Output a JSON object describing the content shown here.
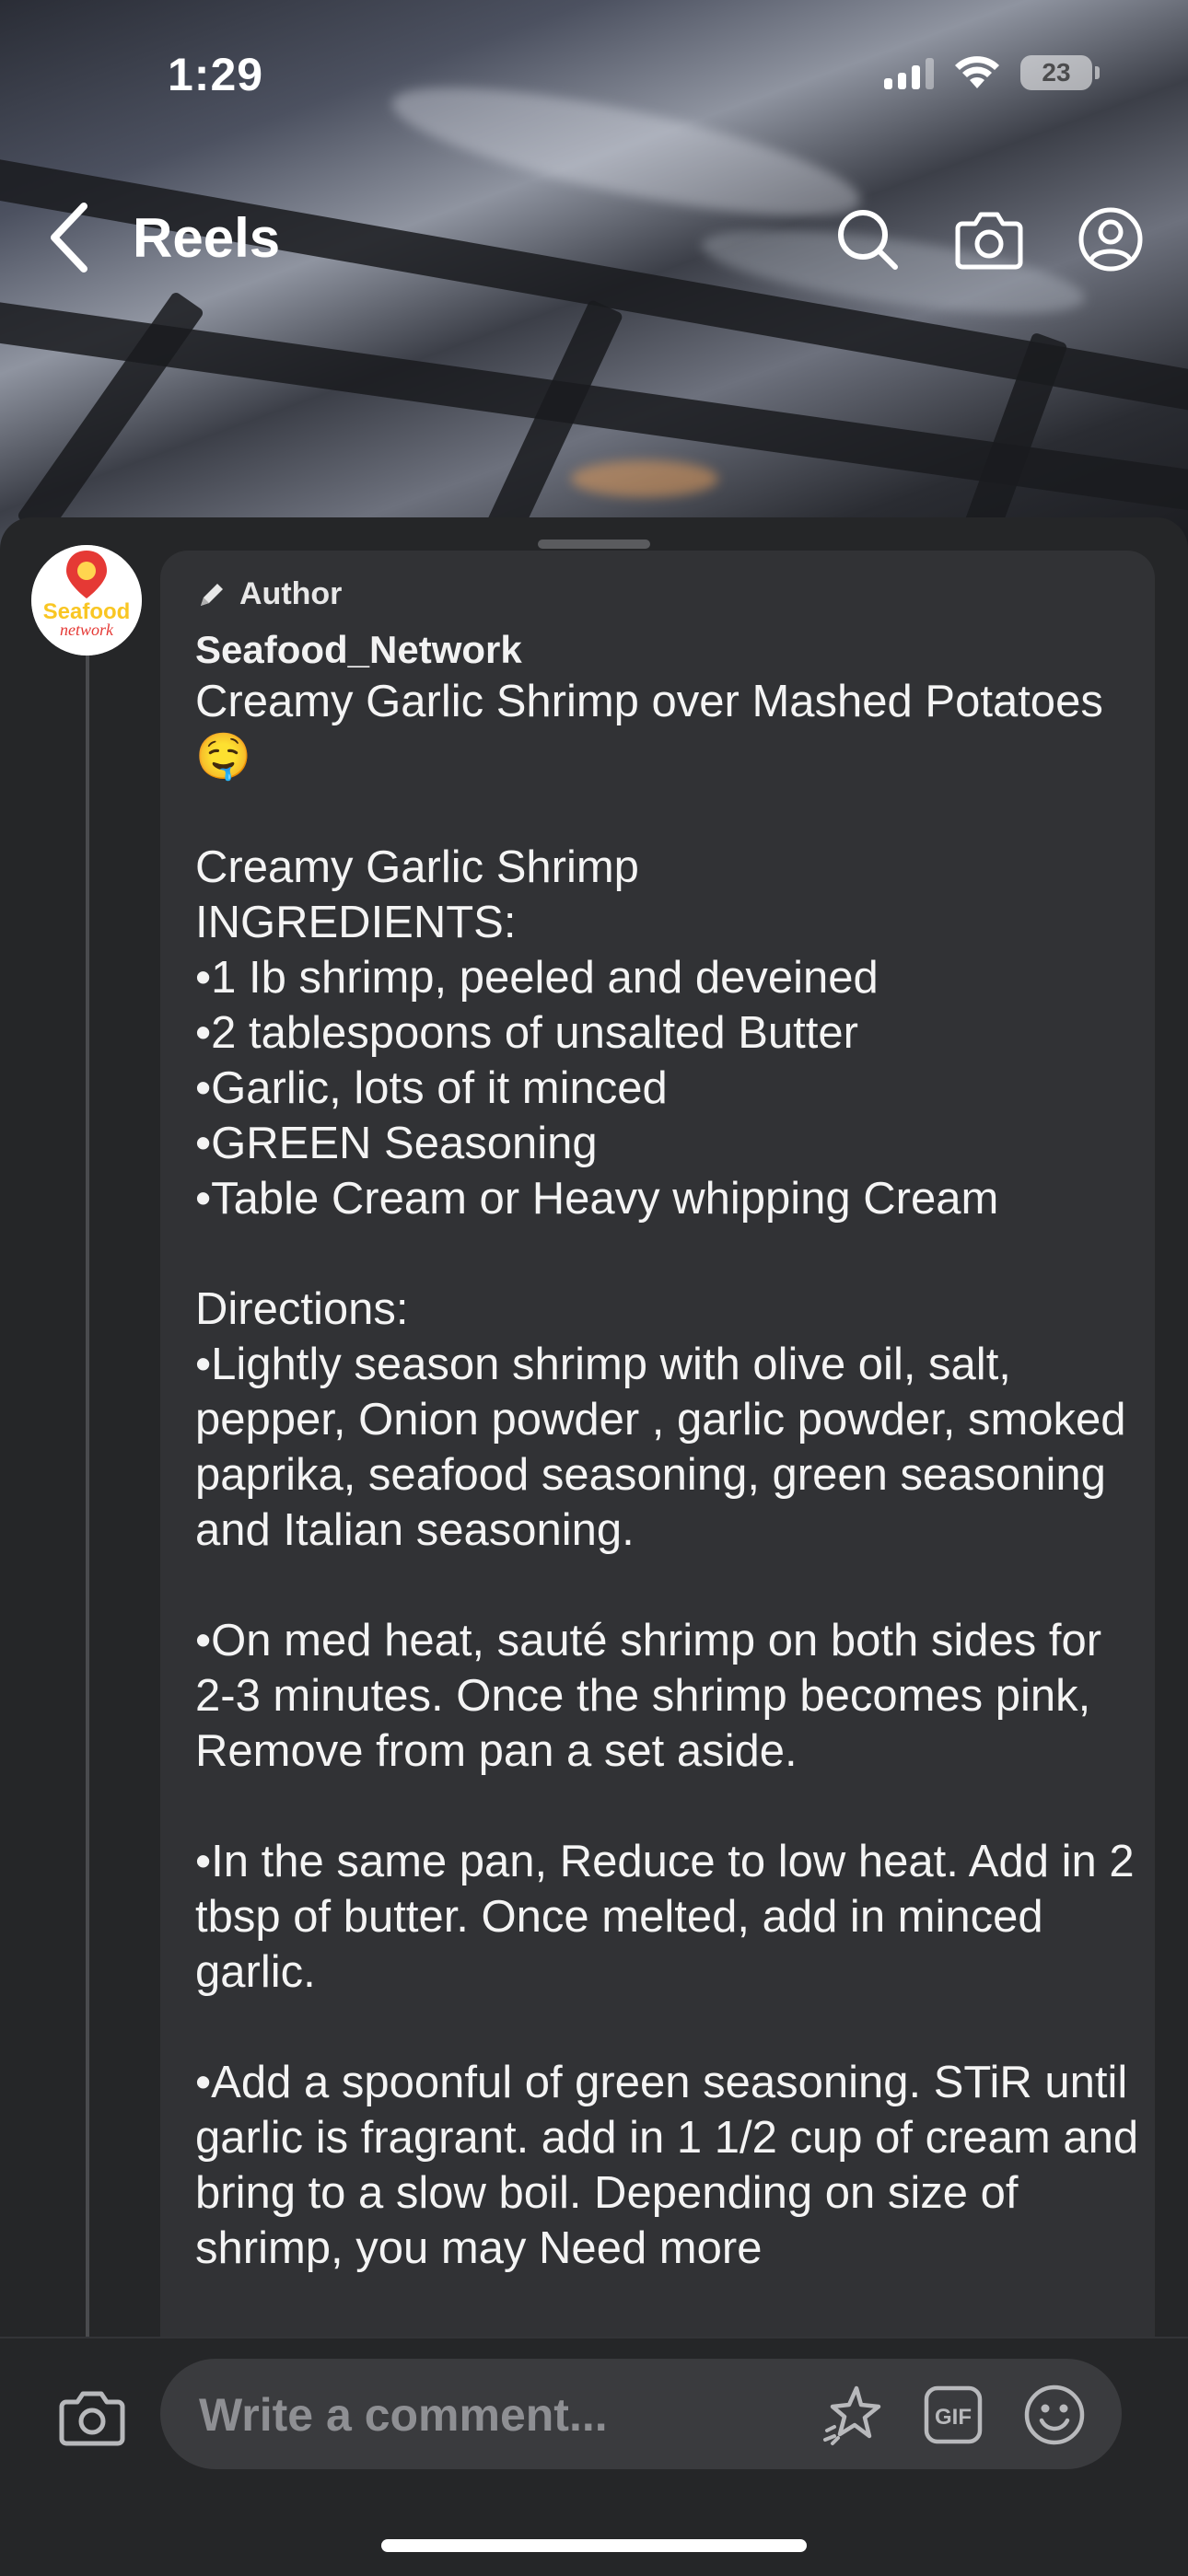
{
  "status_bar": {
    "time": "1:29",
    "battery": "23"
  },
  "nav": {
    "title": "Reels"
  },
  "comment": {
    "badge": "Author",
    "username": "Seafood_Network",
    "avatar_text": [
      "Seafood",
      "network"
    ],
    "text": "Creamy Garlic Shrimp over Mashed Potatoes 🤤\n\nCreamy Garlic Shrimp\nINGREDIENTS:\n•1 Ib shrimp, peeled and deveined\n•2 tablespoons of unsalted Butter\n•Garlic, lots of it minced\n•GREEN Seasoning\n•Table Cream or Heavy whipping Cream\n\nDirections:\n•Lightly season shrimp with olive oil, salt, pepper, Onion powder , garlic powder, smoked paprika, seafood seasoning, green seasoning and Italian seasoning.\n\n•On med heat, sauté shrimp on both sides for 2-3 minutes. Once the shrimp becomes pink, Remove from pan a set aside.\n\n•In the same pan, Reduce to low heat. Add in 2 tbsp of butter. Once melted, add in minced garlic.\n\n•Add a spoonful of green seasoning. STiR until garlic is fragrant. add in 1 1/2 cup of cream and bring to a slow boil. Depending on size of shrimp, you may Need more"
  },
  "composer": {
    "placeholder": "Write a comment...",
    "gif_label": "GIF"
  },
  "colors": {
    "sheet": "#252628",
    "bubble": "#313235",
    "pill": "#3a3b3e"
  }
}
